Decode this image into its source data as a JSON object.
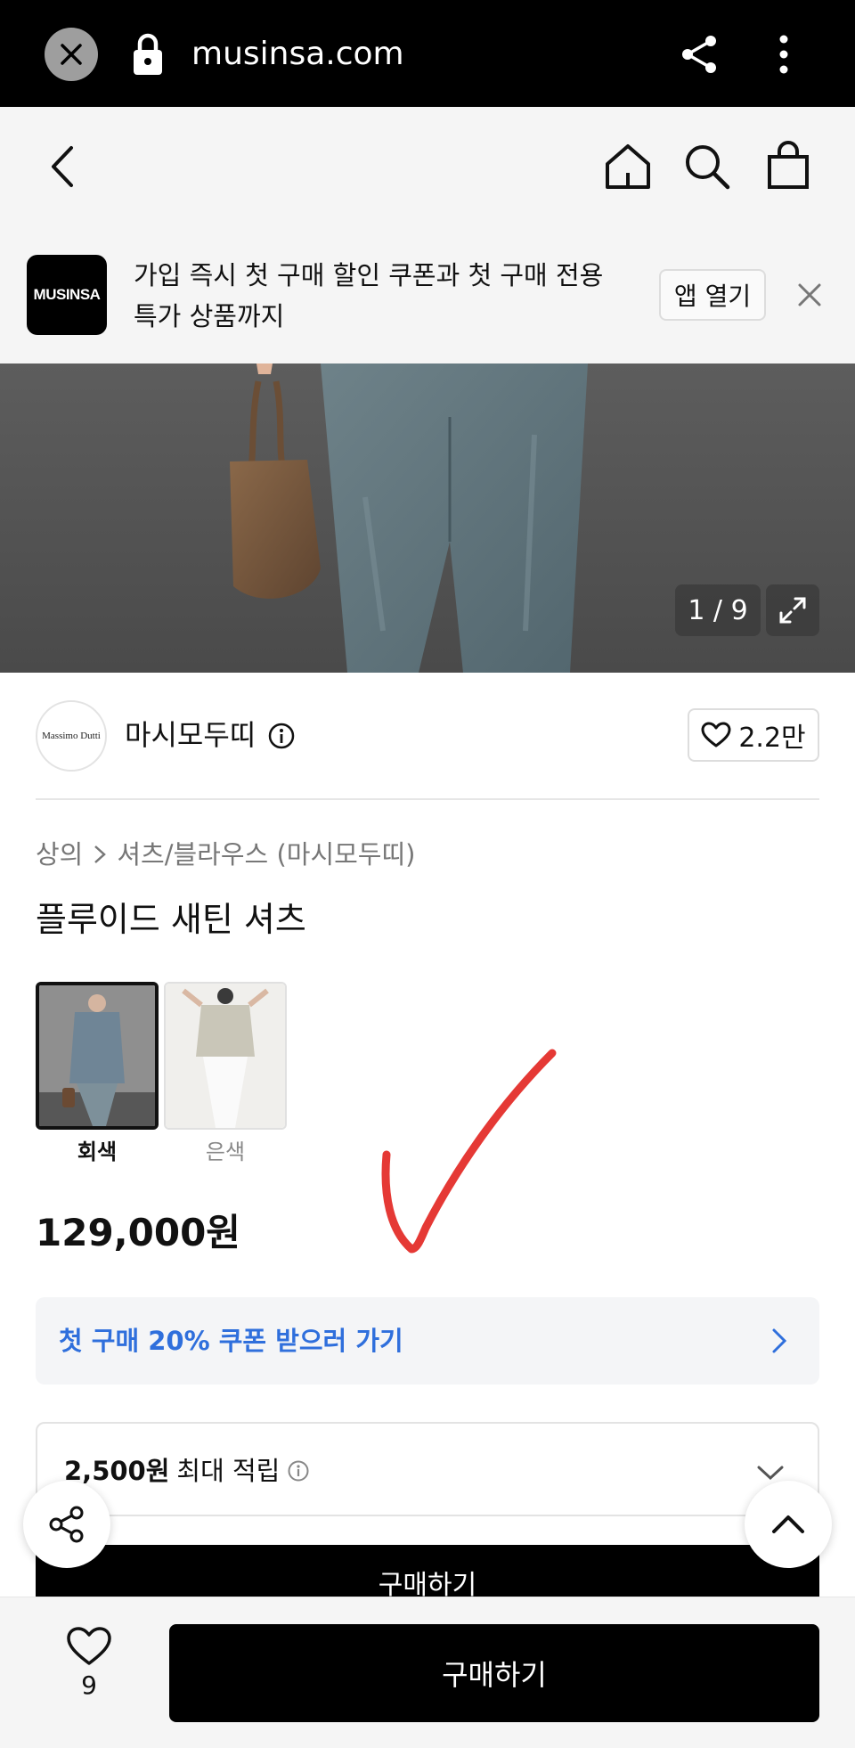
{
  "browser": {
    "url": "musinsa.com"
  },
  "promo": {
    "logo_text": "MUSINSA",
    "line1": "가입 즉시 첫 구매 할인 쿠폰과 첫 구매 전용",
    "line2": "특가 상품까지",
    "open_app_label": "앱 열기"
  },
  "gallery": {
    "counter": "1 / 9"
  },
  "brand": {
    "logo_text": "Massimo Dutti",
    "name": "마시모두띠",
    "like_count": "2.2만"
  },
  "breadcrumb": {
    "category": "상의",
    "subcategory": "셔츠/블라우스 (마시모두띠)"
  },
  "product": {
    "title": "플루이드 새틴 셔츠",
    "colors": [
      {
        "label": "회색",
        "selected": true
      },
      {
        "label": "은색",
        "selected": false
      }
    ],
    "price": "129,000원"
  },
  "coupon": {
    "label": "첫 구매 20% 쿠폰 받으러 가기"
  },
  "points": {
    "amount": "2,500원",
    "label": "최대 적립"
  },
  "buy_strip_label": "구매하기",
  "bottom_bar": {
    "like_count": "9",
    "buy_label": "구매하기"
  },
  "colors": {
    "accent_blue": "#2f6fdc",
    "check_red": "#e53935"
  }
}
